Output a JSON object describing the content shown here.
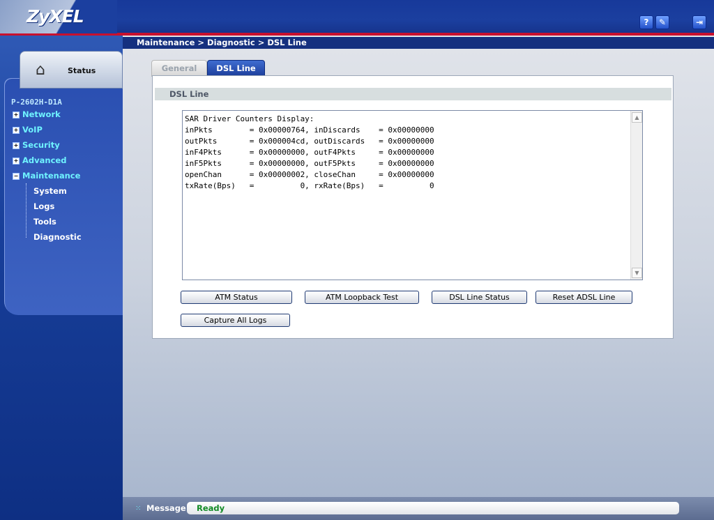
{
  "header": {
    "logo_text": "ZyXEL",
    "help_icon": "?",
    "wizard_icon": "✎",
    "logout_icon": "⇥"
  },
  "sidebar": {
    "status_label": "Status",
    "model": "P-2602H-D1A",
    "menu": [
      {
        "label": "Network",
        "expanded": false
      },
      {
        "label": "VoIP",
        "expanded": false
      },
      {
        "label": "Security",
        "expanded": false
      },
      {
        "label": "Advanced",
        "expanded": false
      },
      {
        "label": "Maintenance",
        "expanded": true
      }
    ],
    "submenu": [
      "System",
      "Logs",
      "Tools",
      "Diagnostic"
    ]
  },
  "breadcrumb": "Maintenance > Diagnostic > DSL Line",
  "tabs": [
    {
      "label": "General",
      "active": false
    },
    {
      "label": "DSL Line",
      "active": true
    }
  ],
  "section_title": "DSL Line",
  "output_text": "SAR Driver Counters Display:\ninPkts        = 0x00000764, inDiscards    = 0x00000000\noutPkts       = 0x000004cd, outDiscards   = 0x00000000\ninF4Pkts      = 0x00000000, outF4Pkts     = 0x00000000\ninF5Pkts      = 0x00000000, outF5Pkts     = 0x00000000\nopenChan      = 0x00000002, closeChan     = 0x00000000\ntxRate(Bps)   =          0, rxRate(Bps)   =          0",
  "buttons": {
    "atm_status": "ATM Status",
    "atm_loopback": "ATM Loopback Test",
    "dsl_line_status": "DSL Line Status",
    "reset_adsl": "Reset ADSL Line",
    "capture_logs": "Capture All Logs"
  },
  "statusbar": {
    "label": "Message",
    "value": "Ready"
  }
}
